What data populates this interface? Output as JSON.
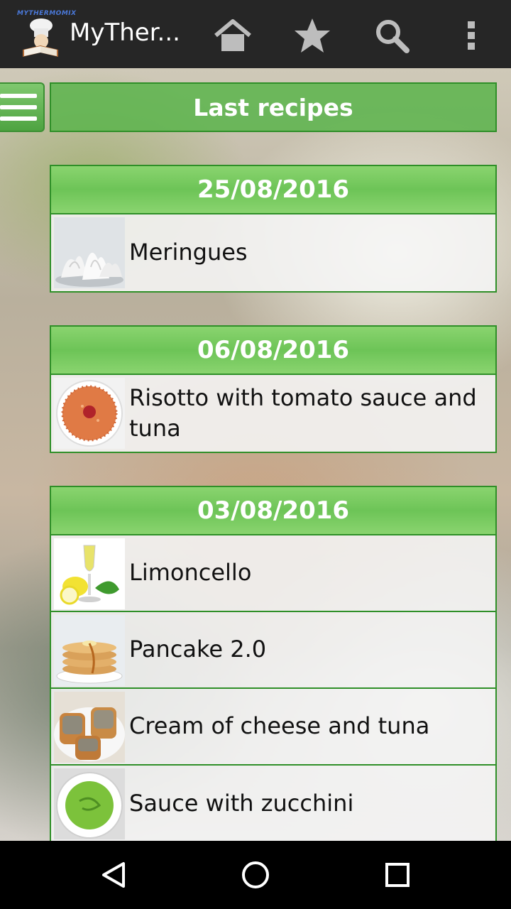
{
  "app": {
    "logo_text": "MYTHERMOMIX",
    "title": "MyTher..."
  },
  "page": {
    "header": "Last recipes"
  },
  "groups": [
    {
      "date": "25/08/2016",
      "recipes": [
        {
          "title": "Meringues",
          "thumb": "meringues-photo"
        }
      ]
    },
    {
      "date": "06/08/2016",
      "recipes": [
        {
          "title": "Risotto with tomato sauce and tuna",
          "thumb": "risotto-photo"
        }
      ]
    },
    {
      "date": "03/08/2016",
      "recipes": [
        {
          "title": "Limoncello",
          "thumb": "limoncello-photo"
        },
        {
          "title": "Pancake 2.0",
          "thumb": "pancake-photo"
        },
        {
          "title": "Cream of cheese and tuna",
          "thumb": "cheese-tuna-photo"
        },
        {
          "title": "Sauce with zucchini",
          "thumb": "zucchini-sauce-photo"
        }
      ]
    }
  ],
  "colors": {
    "actionbar": "#262626",
    "accent_green": "#6dc457",
    "border_green": "#2f8f28"
  },
  "icons": [
    "home-icon",
    "star-icon",
    "search-icon",
    "overflow-menu-icon",
    "hamburger-icon",
    "back-icon",
    "home-circle-icon",
    "recents-icon"
  ]
}
